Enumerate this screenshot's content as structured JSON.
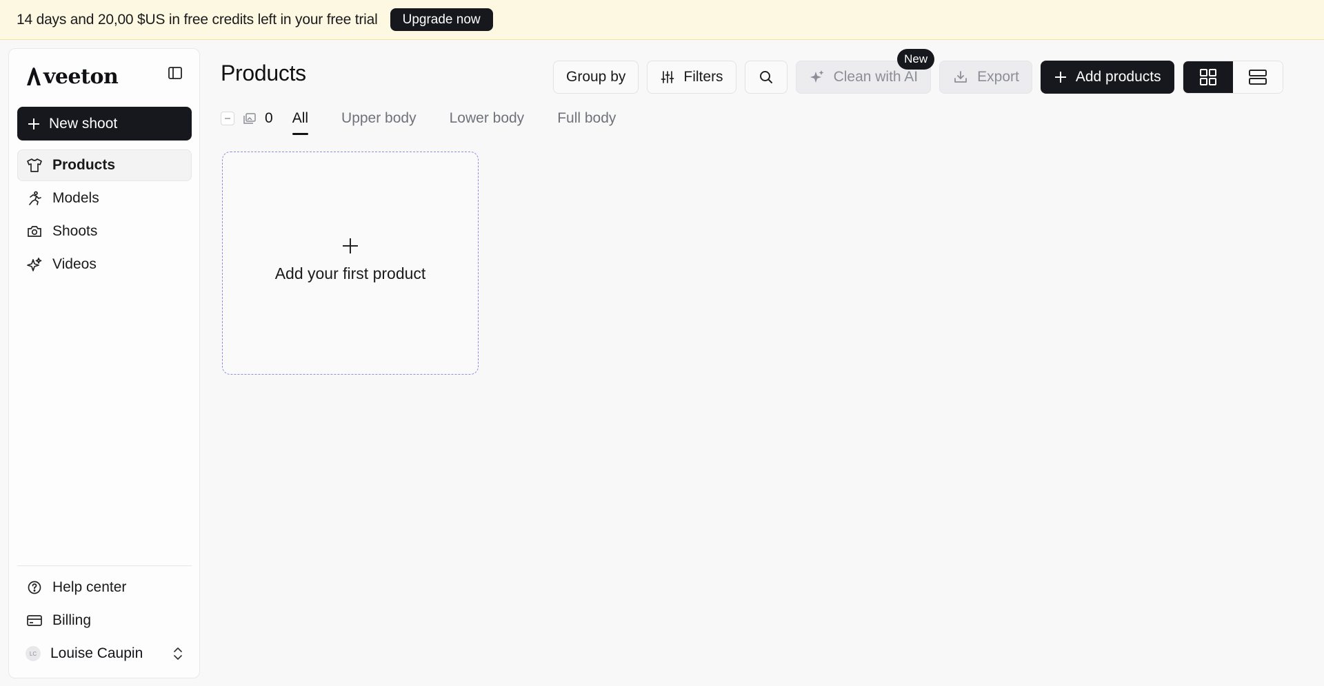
{
  "banner": {
    "text": "14 days and 20,00 $US in free credits left in your free trial",
    "upgrade_label": "Upgrade now"
  },
  "sidebar": {
    "brand": "veeton",
    "new_shoot_label": "New shoot",
    "items": [
      {
        "label": "Products",
        "icon": "shirt-icon",
        "active": true
      },
      {
        "label": "Models",
        "icon": "running-person-icon"
      },
      {
        "label": "Shoots",
        "icon": "camera-icon"
      },
      {
        "label": "Videos",
        "icon": "sparkle-icon"
      }
    ],
    "bottom": {
      "help_label": "Help center",
      "billing_label": "Billing",
      "user_initials": "LC",
      "user_name": "Louise Caupin"
    }
  },
  "main": {
    "title": "Products",
    "toolbar": {
      "group_by_label": "Group by",
      "filters_label": "Filters",
      "clean_label": "Clean with AI",
      "new_badge": "New",
      "export_label": "Export",
      "add_products_label": "Add products"
    },
    "selection_count": "0",
    "tabs": [
      {
        "label": "All",
        "active": true
      },
      {
        "label": "Upper body"
      },
      {
        "label": "Lower body"
      },
      {
        "label": "Full body"
      }
    ],
    "empty_card_label": "Add your first product"
  },
  "colors": {
    "banner_bg": "#fdf8e2",
    "dark": "#16181d",
    "dashed_border": "#8b8ee0"
  }
}
